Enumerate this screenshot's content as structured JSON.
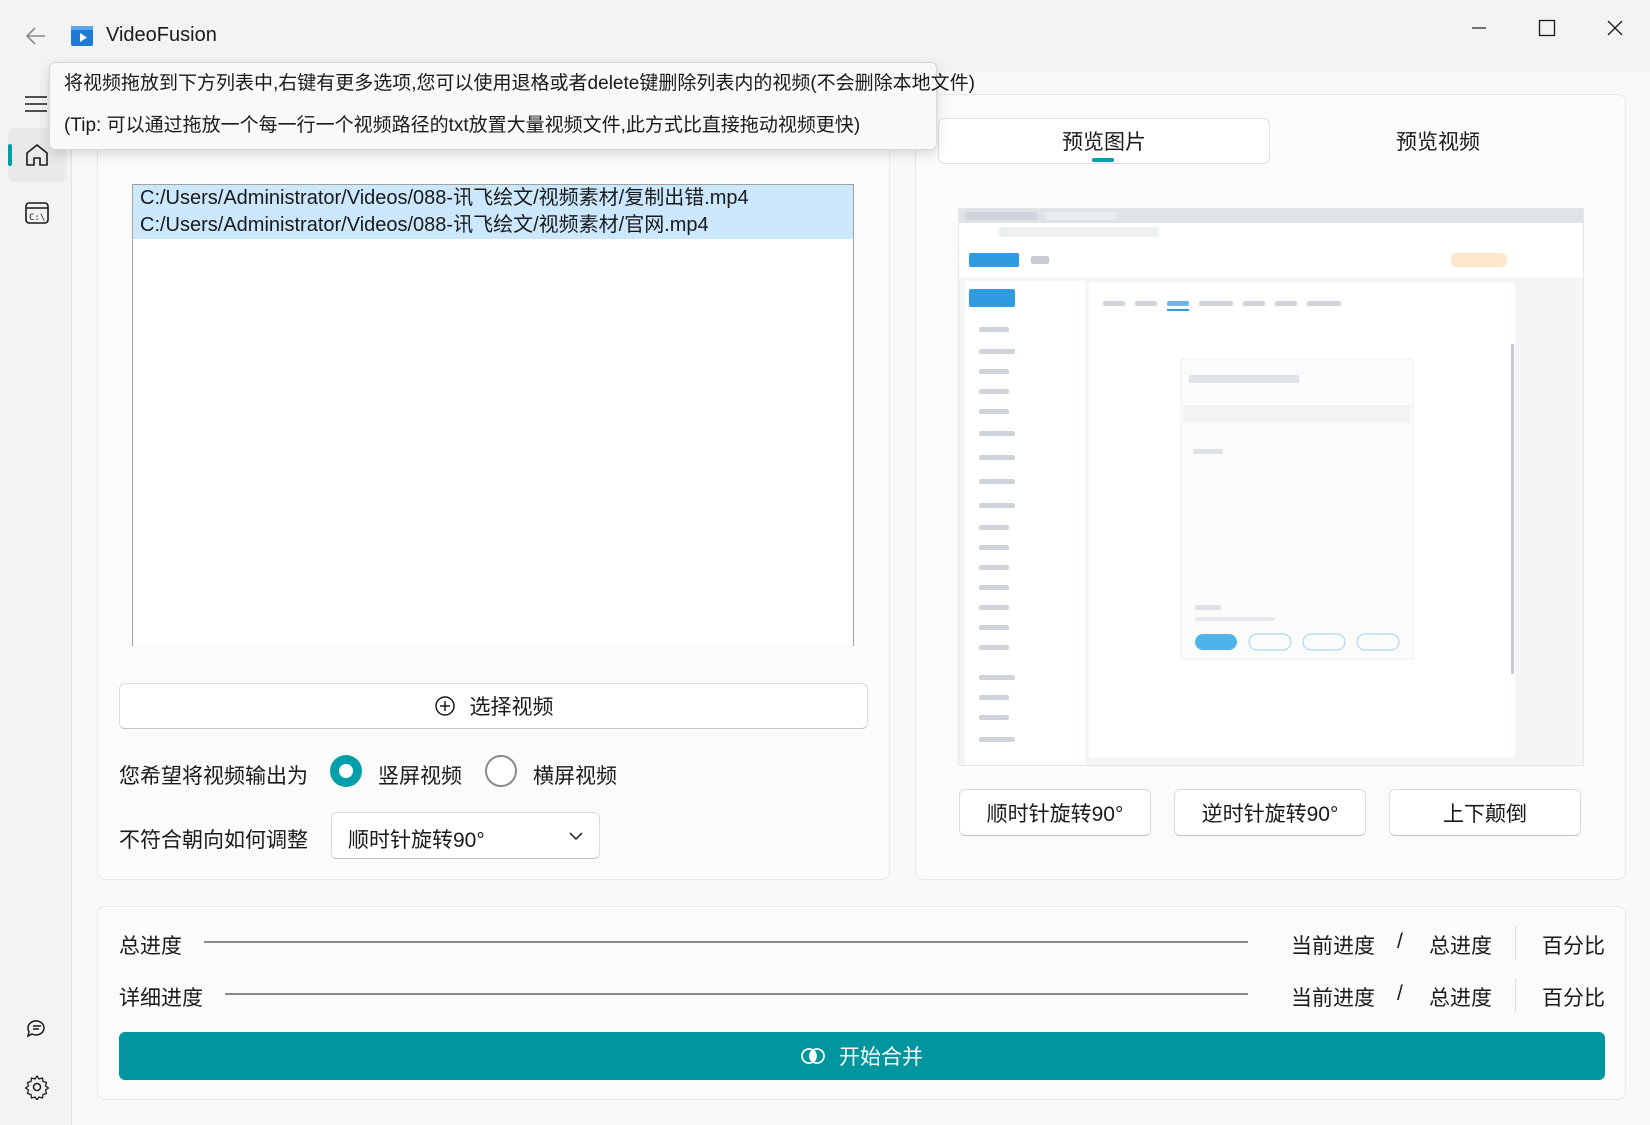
{
  "app": {
    "title": "VideoFusion"
  },
  "sidebar": {
    "items": [
      "home-icon",
      "terminal-icon",
      "feedback-icon",
      "settings-icon"
    ]
  },
  "tooltip": {
    "line1": "将视频拖放到下方列表中,右键有更多选项,您可以使用退格或者delete键删除列表内的视频(不会删除本地文件)",
    "line2": "(Tip: 可以通过拖放一个每一行一个视频路径的txt放置大量视频文件,此方式比直接拖动视频更快)"
  },
  "files": [
    "C:/Users/Administrator/Videos/088-讯飞绘文/视频素材/复制出错.mp4",
    "C:/Users/Administrator/Videos/088-讯飞绘文/视频素材/官网.mp4"
  ],
  "left": {
    "select_button": "选择视频",
    "output_label": "您希望将视频输出为",
    "radio_portrait": "竖屏视频",
    "radio_landscape": "横屏视频",
    "orientation_label": "不符合朝向如何调整",
    "orientation_value": "顺时针旋转90°"
  },
  "right": {
    "tab_image": "预览图片",
    "tab_video": "预览视频",
    "btn_cw": "顺时针旋转90°",
    "btn_ccw": "逆时针旋转90°",
    "btn_flip": "上下颠倒"
  },
  "progress": {
    "total_label": "总进度",
    "detail_label": "详细进度",
    "current": "当前进度",
    "slash": "/",
    "total": "总进度",
    "percent": "百分比"
  },
  "start_button": "开始合并",
  "colors": {
    "accent": "#009faa",
    "start": "#00959f",
    "selection": "#cce8ff"
  }
}
